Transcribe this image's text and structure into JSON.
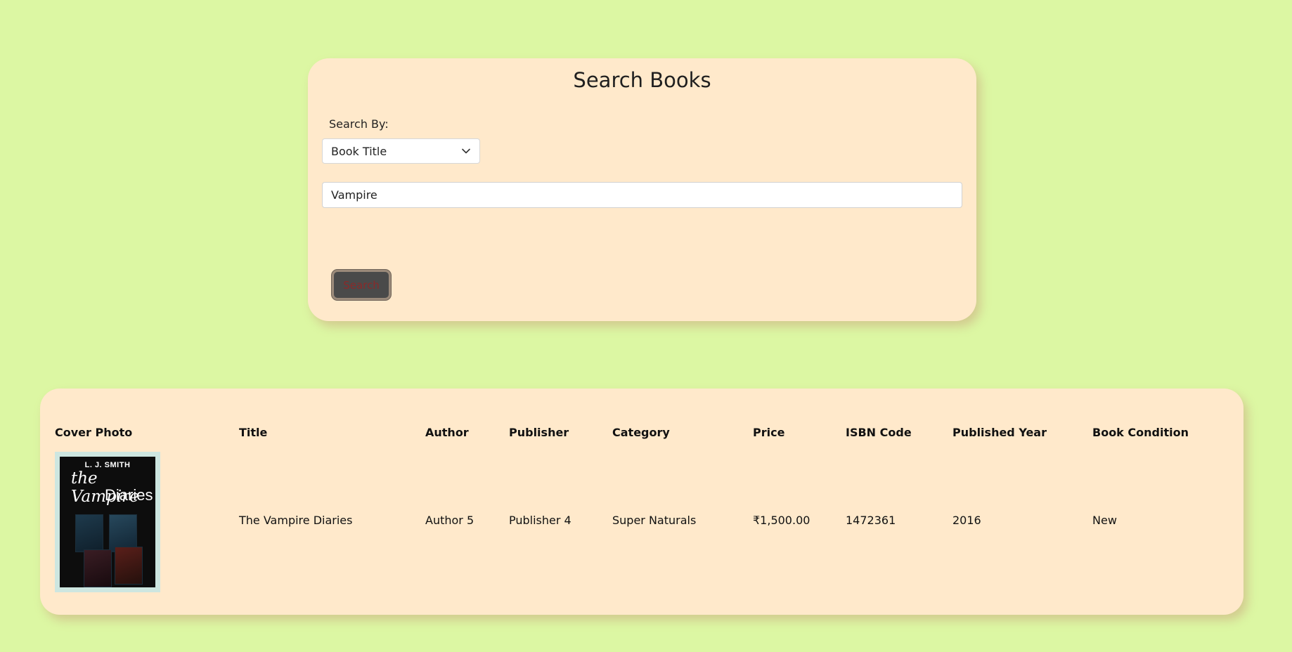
{
  "search": {
    "title": "Search Books",
    "search_by_label": "Search By:",
    "select_value": "Book Title",
    "input_value": "Vampire",
    "button_label": "Search"
  },
  "results": {
    "headers": [
      "Cover Photo",
      "Title",
      "Author",
      "Publisher",
      "Category",
      "Price",
      "ISBN Code",
      "Published Year",
      "Book Condition"
    ],
    "rows": [
      {
        "cover": {
          "author": "L. J. SMITH",
          "title_line1": "the Vampire",
          "title_line2": "Diaries"
        },
        "title": "The Vampire Diaries",
        "author": "Author 5",
        "publisher": "Publisher 4",
        "category": "Super Naturals",
        "price": "₹1,500.00",
        "isbn": "1472361",
        "year": "2016",
        "condition": "New"
      }
    ]
  },
  "colors": {
    "page_bg": "#dcf7a3",
    "card_bg": "#ffe9cb",
    "button_bg": "#4a4a4a",
    "button_text": "#8a2a2a"
  }
}
